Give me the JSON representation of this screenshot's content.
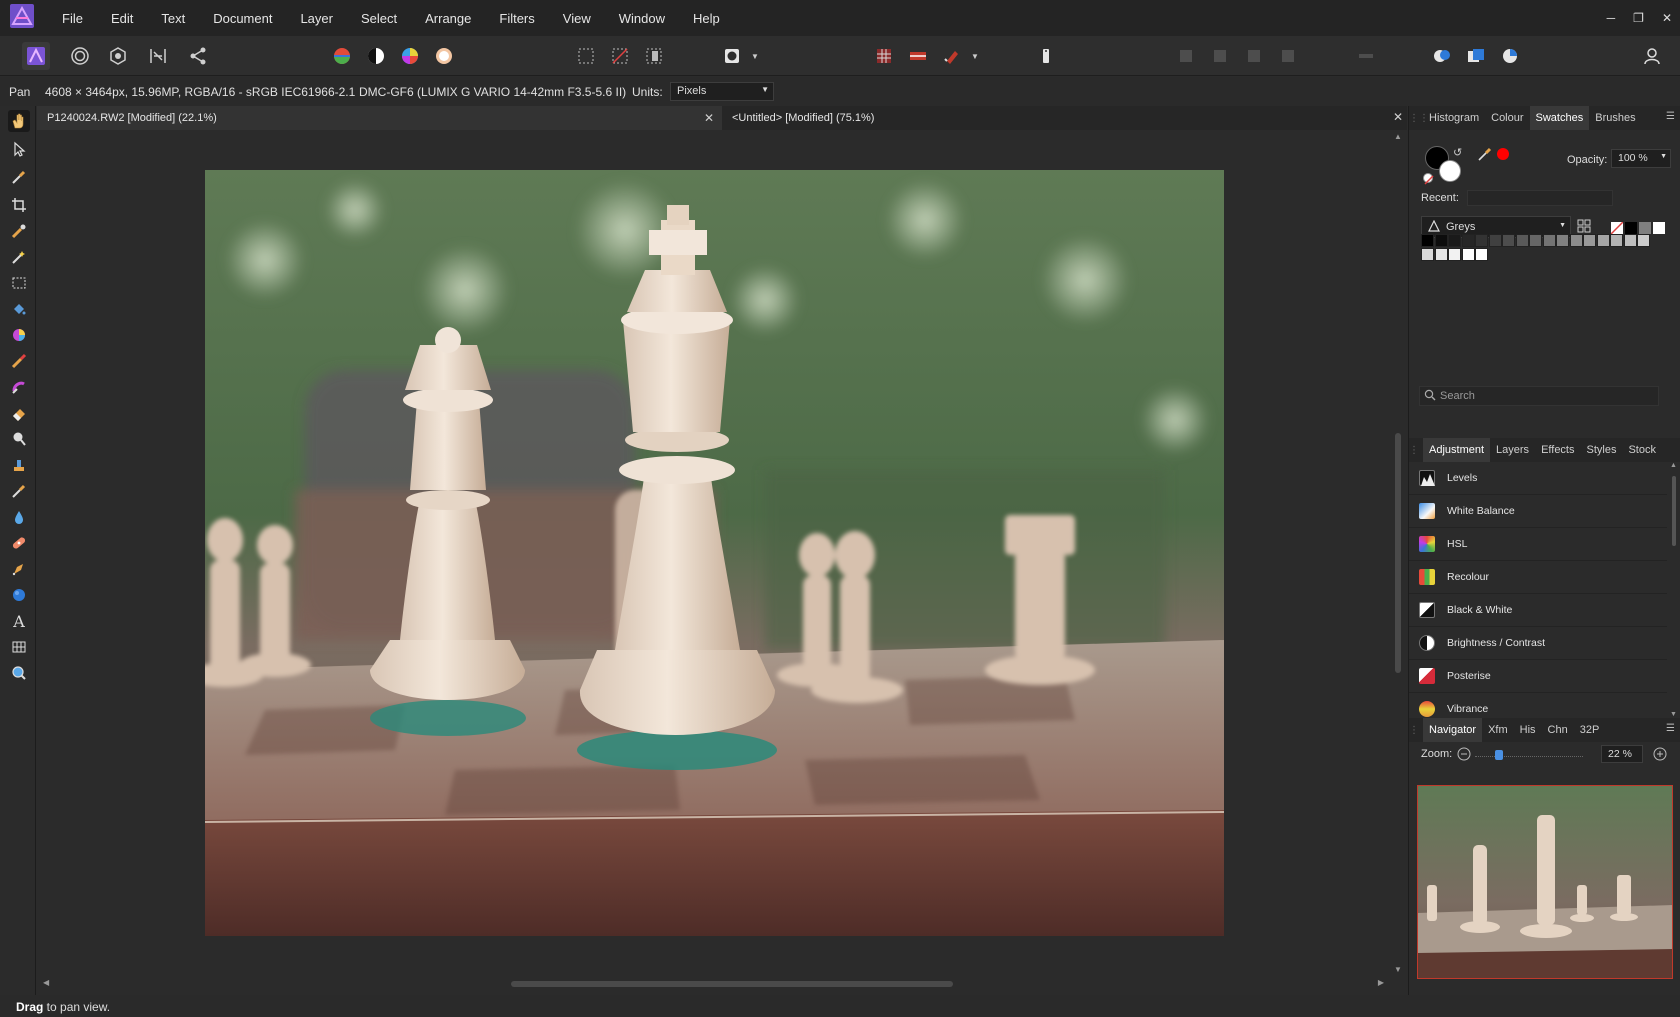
{
  "menubar": {
    "items": [
      "File",
      "Edit",
      "Text",
      "Document",
      "Layer",
      "Select",
      "Arrange",
      "Filters",
      "View",
      "Window",
      "Help"
    ],
    "window_controls": [
      "minimize-icon",
      "restore-icon",
      "close-icon"
    ]
  },
  "context": {
    "tool": "Pan",
    "image_info": "4608 × 3464px, 15.96MP, RGBA/16 - sRGB IEC61966-2.1",
    "camera": "DMC-GF6 (LUMIX G VARIO 14-42mm F3.5-5.6 II)",
    "units_label": "Units:",
    "units_value": "Pixels"
  },
  "tabs": [
    {
      "label": "P1240024.RW2 [Modified] (22.1%)"
    },
    {
      "label": "<Untitled> [Modified] (75.1%)"
    }
  ],
  "status": {
    "bold": "Drag",
    "text": " to pan view."
  },
  "swatches_panel": {
    "tabs": [
      "Histogram",
      "Colour",
      "Swatches",
      "Brushes"
    ],
    "selected_tab": "Swatches",
    "opacity_label": "Opacity:",
    "opacity_value": "100 %",
    "recent_label": "Recent:",
    "palette": "Greys",
    "search_placeholder": "Search",
    "grey_colors": [
      "#000000",
      "#0d0d0d",
      "#1a1a1a",
      "#262626",
      "#333333",
      "#404040",
      "#4d4d4d",
      "#595959",
      "#666666",
      "#737373",
      "#808080",
      "#8c8c8c",
      "#999999",
      "#a6a6a6",
      "#b3b3b3",
      "#bfbfbf",
      "#cccccc",
      "#d9d9d9",
      "#e6e6e6",
      "#f2f2f2",
      "#ffffff",
      "#ffffff"
    ]
  },
  "adjustment_panel": {
    "tabs": [
      "Adjustment",
      "Layers",
      "Effects",
      "Styles",
      "Stock"
    ],
    "selected_tab": "Adjustment",
    "items": [
      {
        "label": "Levels"
      },
      {
        "label": "White Balance"
      },
      {
        "label": "HSL"
      },
      {
        "label": "Recolour"
      },
      {
        "label": "Black & White"
      },
      {
        "label": "Brightness / Contrast"
      },
      {
        "label": "Posterise"
      },
      {
        "label": "Vibrance"
      }
    ]
  },
  "navigator_panel": {
    "tabs": [
      "Navigator",
      "Xfm",
      "His",
      "Chn",
      "32P"
    ],
    "selected_tab": "Navigator",
    "zoom_label": "Zoom:",
    "zoom_value": "22 %",
    "zoom_level_percent": 22
  }
}
